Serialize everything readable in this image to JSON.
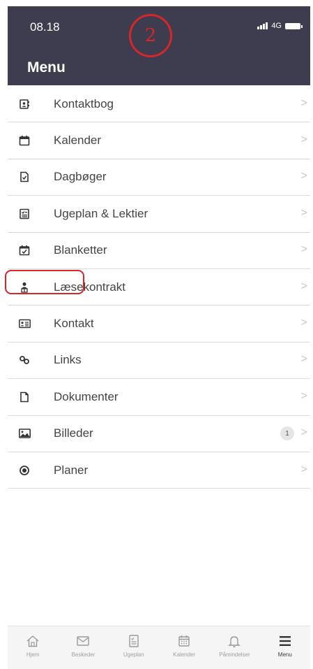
{
  "status_bar": {
    "time": "08.18",
    "network": "4G"
  },
  "header": {
    "title": "Menu"
  },
  "annotation": {
    "number": "2"
  },
  "menu": {
    "items": [
      {
        "label": "Kontaktbog",
        "icon": "contact-book-icon"
      },
      {
        "label": "Kalender",
        "icon": "calendar-icon"
      },
      {
        "label": "Dagbøger",
        "icon": "diary-icon"
      },
      {
        "label": "Ugeplan & Lektier",
        "icon": "checklist-icon"
      },
      {
        "label": "Blanketter",
        "icon": "form-calendar-icon"
      },
      {
        "label": "Læsekontrakt",
        "icon": "reading-contract-icon"
      },
      {
        "label": "Kontakt",
        "icon": "contact-card-icon"
      },
      {
        "label": "Links",
        "icon": "link-icon"
      },
      {
        "label": "Dokumenter",
        "icon": "document-icon"
      },
      {
        "label": "Billeder",
        "icon": "image-icon",
        "badge": "1"
      },
      {
        "label": "Planer",
        "icon": "target-icon"
      }
    ],
    "chevron": ">"
  },
  "tabbar": {
    "tabs": [
      {
        "label": "Hjem",
        "icon": "home-icon"
      },
      {
        "label": "Beskeder",
        "icon": "mail-icon"
      },
      {
        "label": "Ugeplan",
        "icon": "checklist-icon"
      },
      {
        "label": "Kalender",
        "icon": "calendar-icon"
      },
      {
        "label": "Påmindelser",
        "icon": "bell-icon"
      },
      {
        "label": "Menu",
        "icon": "hamburger-icon",
        "active": true
      }
    ]
  },
  "colors": {
    "header_bg": "#3e3c4f",
    "annotation": "#d6262a"
  }
}
